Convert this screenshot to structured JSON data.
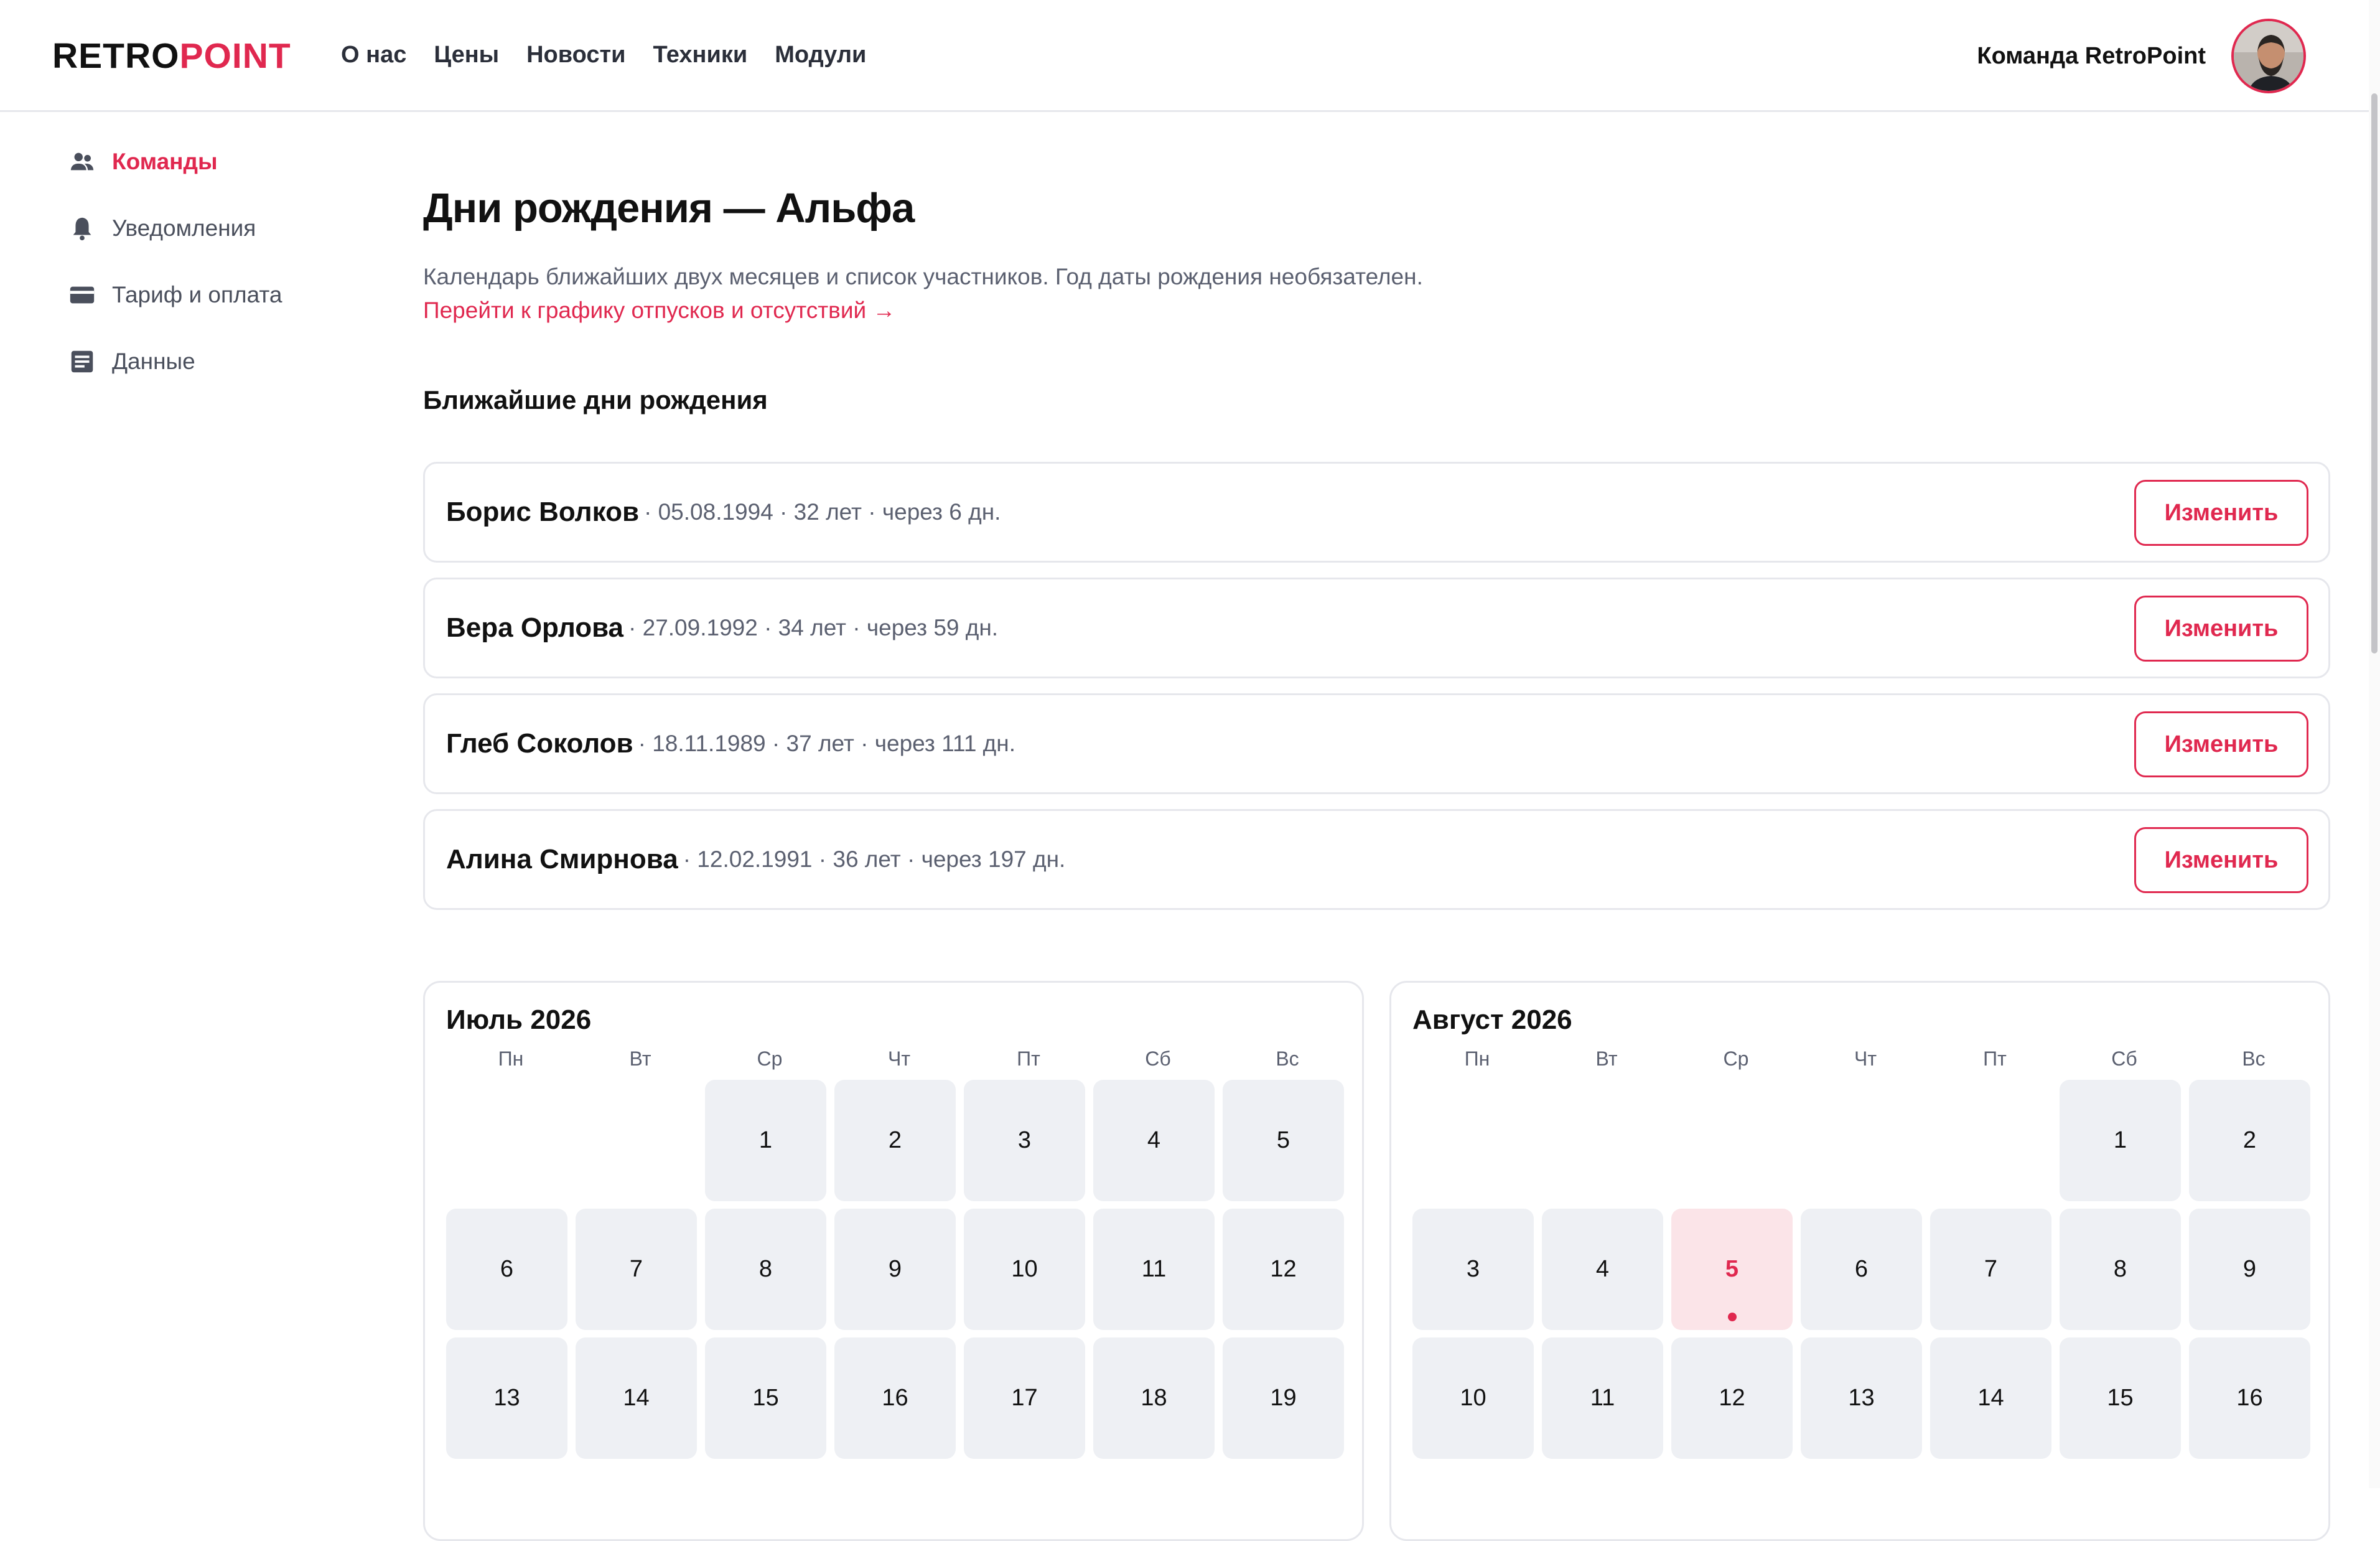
{
  "header": {
    "logo_a": "RETRO",
    "logo_b": "POINT",
    "nav": [
      "О нас",
      "Цены",
      "Новости",
      "Техники",
      "Модули"
    ],
    "team_name": "Команда RetroPoint"
  },
  "sidebar": {
    "items": [
      {
        "label": "Команды",
        "icon": "users-icon",
        "active": true
      },
      {
        "label": "Уведомления",
        "icon": "bell-icon"
      },
      {
        "label": "Тариф и оплата",
        "icon": "credit-card-icon"
      },
      {
        "label": "Данные",
        "icon": "data-icon"
      }
    ]
  },
  "page": {
    "title": "Дни рождения — Альфа",
    "subtitle": "Календарь ближайших двух месяцев и список участников. Год даты рождения необязателен.",
    "link": "Перейти к графику отпусков и отсутствий →",
    "section_title": "Ближайшие дни рождения"
  },
  "birthdays": [
    {
      "name": "Борис Волков",
      "meta": "· 05.08.1994 · 32 лет · через 6 дн.",
      "action": "Изменить"
    },
    {
      "name": "Вера Орлова",
      "meta": "· 27.09.1992 · 34 лет · через 59 дн.",
      "action": "Изменить"
    },
    {
      "name": "Глеб Соколов",
      "meta": "· 18.11.1989 · 37 лет · через 111 дн.",
      "action": "Изменить"
    },
    {
      "name": "Алина Смирнова",
      "meta": "· 12.02.1991 · 36 лет · через 197 дн.",
      "action": "Изменить"
    }
  ],
  "calendars": [
    {
      "title": "Июль 2026",
      "weekdays": [
        "Пн",
        "Вт",
        "Ср",
        "Чт",
        "Пт",
        "Сб",
        "Вс"
      ],
      "lead_blanks": 2,
      "visible_days": 19,
      "highlight": null
    },
    {
      "title": "Август 2026",
      "weekdays": [
        "Пн",
        "Вт",
        "Ср",
        "Чт",
        "Пт",
        "Сб",
        "Вс"
      ],
      "lead_blanks": 5,
      "visible_days": 16,
      "highlight": 5
    }
  ],
  "colors": {
    "accent": "#e0284f",
    "highlight_bg": "#fbe4e8",
    "day_bg": "#eef0f4",
    "border": "#e6e7ec",
    "muted_text": "#5b6070"
  }
}
